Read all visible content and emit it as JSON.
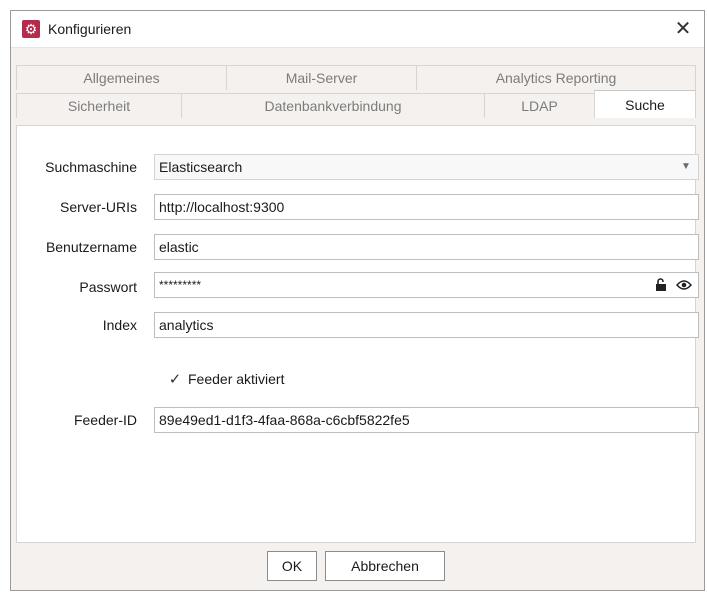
{
  "window": {
    "title": "Konfigurieren",
    "close_symbol": "✕",
    "app_icon": "gear-icon",
    "app_icon_color": "#b42b4c"
  },
  "tabs": {
    "row_top": [
      "Allgemeines",
      "Mail-Server",
      "Analytics Reporting"
    ],
    "row_bottom": [
      "Sicherheit",
      "Datenbankverbindung",
      "LDAP",
      "Suche"
    ],
    "active": "Suche"
  },
  "form": {
    "search_engine_label": "Suchmaschine",
    "search_engine_value": "Elasticsearch",
    "server_uris_label": "Server-URIs",
    "server_uris_value": "http://localhost:9300",
    "username_label": "Benutzername",
    "username_value": "elastic",
    "password_label": "Passwort",
    "password_value": "*********",
    "index_label": "Index",
    "index_value": "analytics",
    "feeder_checkbox_label": "Feeder aktiviert",
    "feeder_checked": true,
    "feeder_id_label": "Feeder-ID",
    "feeder_id_value": "89e49ed1-d1f3-4faa-868a-c6cbf5822fe5"
  },
  "buttons": {
    "ok": "OK",
    "cancel": "Abbrechen"
  }
}
